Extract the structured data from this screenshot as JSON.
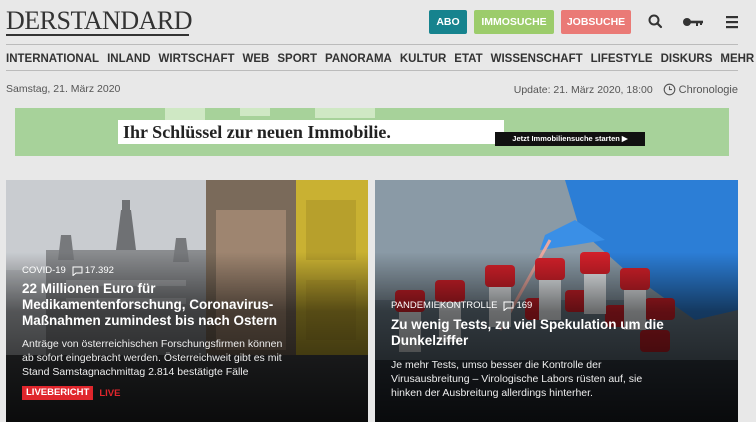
{
  "header": {
    "logo": "DERSTANDARD",
    "buttons": {
      "abo": "ABO",
      "immosuche": "IMMOSUCHE",
      "jobsuche": "JOBSUCHE"
    },
    "icons": [
      "search-icon",
      "key-icon",
      "menu-icon"
    ]
  },
  "nav": {
    "items": [
      "INTERNATIONAL",
      "INLAND",
      "WIRTSCHAFT",
      "WEB",
      "SPORT",
      "PANORAMA",
      "KULTUR",
      "ETAT",
      "WISSENSCHAFT",
      "LIFESTYLE",
      "DISKURS",
      "MEHR …"
    ]
  },
  "datebar": {
    "date": "Samstag, 21. März 2020",
    "update": "Update: 21. März 2020, 18:00",
    "chronologie": "Chronologie"
  },
  "ad": {
    "headline": "Ihr Schlüssel zur neuen Immobilie.",
    "cta": "Jetzt Immobiliensuche starten ▶"
  },
  "articles": [
    {
      "kicker": "COVID-19",
      "comments": "17.392",
      "title_lines": [
        "22 Millionen Euro für",
        "Medikamentenforschung, Coronavirus-",
        "Maßnahmen zumindest bis nach Ostern"
      ],
      "teaser_lines": [
        "Anträge von österreichischen Forschungsfirmen können",
        "ab sofort eingebracht werden. Österreichweit gibt es mit",
        "Stand Samstagnachmittag 2.814 bestätigte Fälle"
      ],
      "badge": "LIVEBERICHT",
      "live": "LIVE"
    },
    {
      "kicker": "PANDEMIEKONTROLLE",
      "comments": "169",
      "title_lines": [
        "Zu wenig Tests, zu viel Spekulation um die",
        "Dunkelziffer"
      ],
      "teaser_lines": [
        "Je mehr Tests, umso besser die Kontrolle der",
        "Virusausbreitung – Virologische Labors rüsten auf, sie",
        "hinken der Ausbreitung allerdings hinterher."
      ]
    }
  ],
  "colors": {
    "abo": "#16838e",
    "immosuche": "#9ccc6b",
    "jobsuche": "#ea7a76",
    "live_red": "#e0262c",
    "ad_green": "#a7d29a"
  }
}
